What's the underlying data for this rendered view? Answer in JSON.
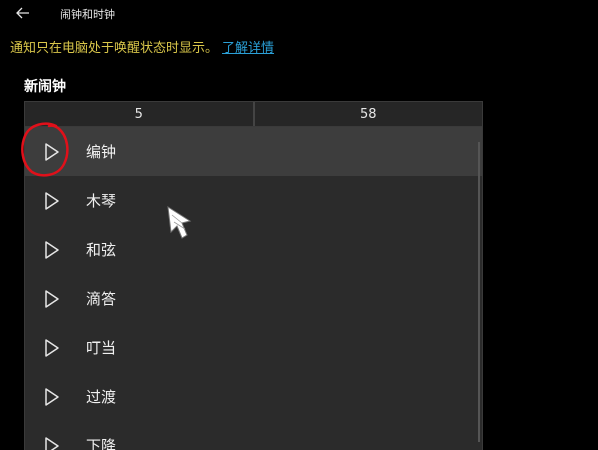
{
  "window": {
    "title": "闹钟和时钟"
  },
  "notice": {
    "text": "通知只在电脑处于唤醒状态时显示。",
    "link": "了解详情"
  },
  "section": {
    "title": "新闹钟"
  },
  "time_picker": {
    "hour": "5",
    "minute": "58"
  },
  "sounds": [
    {
      "label": "编钟",
      "selected": true
    },
    {
      "label": "木琴",
      "selected": false
    },
    {
      "label": "和弦",
      "selected": false
    },
    {
      "label": "滴答",
      "selected": false
    },
    {
      "label": "叮当",
      "selected": false
    },
    {
      "label": "过渡",
      "selected": false
    },
    {
      "label": "下降",
      "selected": false
    }
  ],
  "colors": {
    "background": "#000000",
    "panel": "#2b2b2b",
    "selected_row": "#3d3d3d",
    "notice_text": "#d9c64a",
    "link": "#2a9fd6",
    "annotation": "#e0101a"
  },
  "icons": {
    "back": "arrow-left-icon",
    "play": "play-triangle-icon"
  }
}
